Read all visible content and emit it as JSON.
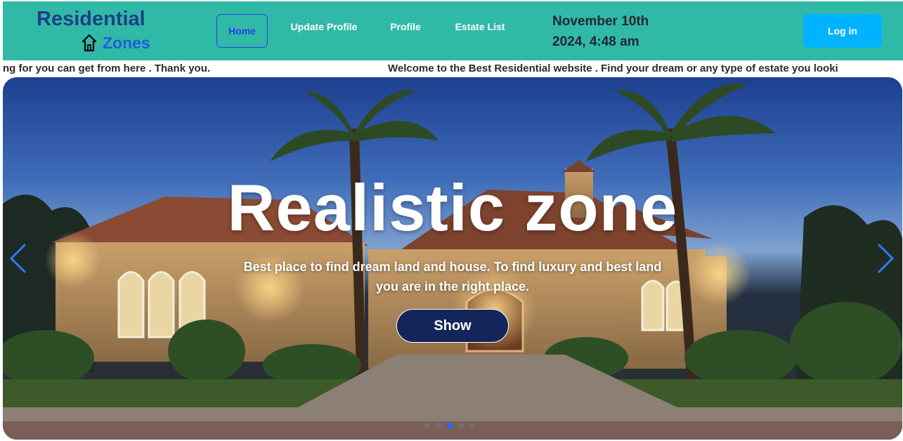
{
  "brand": {
    "line1": "Residential",
    "line2": "Zones",
    "icon": "house-outline-icon"
  },
  "nav": {
    "home": "Home",
    "update_profile": "Update Profile",
    "profile": "Profile",
    "estate_list": "Estate List"
  },
  "datetime": {
    "line1": "November 10th",
    "line2": "2024, 4:48 am"
  },
  "login_label": "Log in",
  "marquee": {
    "part_a": "ng for you can get from here . Thank you.",
    "part_b": "Welcome to the Best Residential website . Find your dream or any type of estate you looki"
  },
  "hero": {
    "title": "Realistic zone",
    "subtitle": "Best place to find dream land and house. To find luxury and best land you are in the right place.",
    "button": "Show",
    "prev_icon": "chevron-left-icon",
    "next_icon": "chevron-right-icon",
    "slides": 5,
    "active_slide": 3
  },
  "colors": {
    "navbar": "#31b9a8",
    "brand_primary": "#1f3f86",
    "brand_secondary": "#1f5fd6",
    "login_button": "#00b3ff",
    "show_button": "#13255a",
    "active_dot": "#1e6cff"
  }
}
